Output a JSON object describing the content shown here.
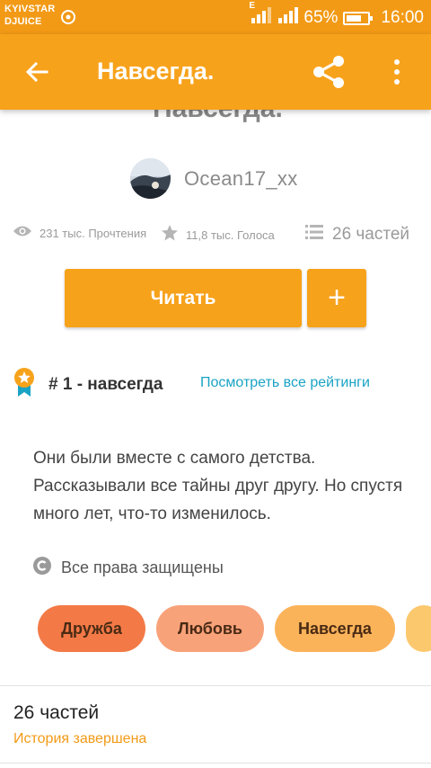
{
  "status_bar": {
    "carrier_line1": "KYIVSTAR",
    "carrier_line2": "DJUICE",
    "signal_type": "E",
    "battery": "65%",
    "time": "16:00"
  },
  "app_bar": {
    "title": "Навсегда.",
    "back_icon": "arrow-left-icon",
    "share_icon": "share-icon",
    "more_icon": "more-vert-icon"
  },
  "story": {
    "title_partial": "Навсегда.",
    "author": "Ocean17_xx",
    "reads": "231 тыс. Прочтения",
    "votes": "11,8 тыс. Голоса",
    "parts": "26 частей",
    "read_button": "Читать",
    "add_button": "+",
    "rank": "# 1 - навсегда",
    "rank_link": "Посмотреть все рейтинги",
    "description": "Они были вместе с самого детства. Рассказывали все тайны друг другу. Но спустя много лет, что-то изменилось.",
    "copyright": "Все права защищены",
    "tags": [
      {
        "label": "Дружба",
        "color": "#f37a47"
      },
      {
        "label": "Любовь",
        "color": "#f8a27a"
      },
      {
        "label": "Навсегда",
        "color": "#fbb35a"
      }
    ],
    "parts_section": {
      "count": "26 частей",
      "status": "История завершена"
    }
  },
  "colors": {
    "accent": "#f7a21b",
    "link": "#1aa3c4",
    "status_orange": "#f29a16"
  }
}
